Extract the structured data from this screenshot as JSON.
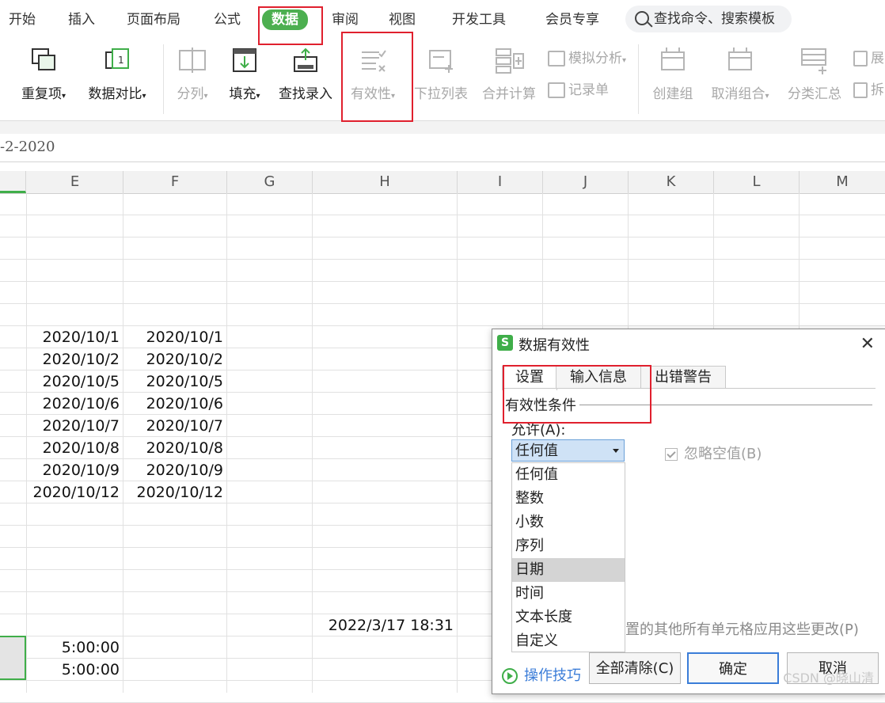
{
  "menubar": {
    "items": [
      "开始",
      "插入",
      "页面布局",
      "公式",
      "数据",
      "审阅",
      "视图",
      "开发工具",
      "会员专享"
    ],
    "active": "数据",
    "search_text": "查找命令、搜索模板"
  },
  "ribbon": {
    "buttons": [
      {
        "label": "重复项",
        "dropdown": true,
        "enabled": true,
        "icon": "duplicate-icon"
      },
      {
        "label": "数据对比",
        "dropdown": true,
        "enabled": true,
        "icon": "compare-icon"
      },
      {
        "label": "分列",
        "dropdown": true,
        "enabled": false,
        "icon": "split-column-icon"
      },
      {
        "label": "填充",
        "dropdown": true,
        "enabled": true,
        "icon": "fill-down-icon"
      },
      {
        "label": "查找录入",
        "dropdown": false,
        "enabled": true,
        "icon": "find-entry-icon"
      },
      {
        "label": "有效性",
        "dropdown": true,
        "enabled": false,
        "icon": "validation-icon"
      },
      {
        "label": "下拉列表",
        "dropdown": false,
        "enabled": false,
        "icon": "dropdown-list-icon"
      },
      {
        "label": "合并计算",
        "dropdown": false,
        "enabled": false,
        "icon": "consolidate-icon"
      },
      {
        "label": "创建组",
        "dropdown": false,
        "enabled": false,
        "icon": "group-icon"
      },
      {
        "label": "取消组合",
        "dropdown": true,
        "enabled": false,
        "icon": "ungroup-icon"
      },
      {
        "label": "分类汇总",
        "dropdown": false,
        "enabled": false,
        "icon": "subtotal-icon"
      }
    ],
    "small_buttons": [
      {
        "label": "模拟分析",
        "dropdown": true
      },
      {
        "label": "记录单",
        "dropdown": false
      }
    ],
    "partial": [
      "展",
      "拆"
    ]
  },
  "formula_bar": {
    "value": "-2-2020"
  },
  "grid": {
    "columns": [
      "E",
      "F",
      "G",
      "H",
      "I",
      "J",
      "K",
      "L",
      "M"
    ],
    "cells": [
      {
        "col": "E",
        "row": 7,
        "value": "2020/10/1"
      },
      {
        "col": "F",
        "row": 7,
        "value": "2020/10/1"
      },
      {
        "col": "E",
        "row": 8,
        "value": "2020/10/2"
      },
      {
        "col": "F",
        "row": 8,
        "value": "2020/10/2"
      },
      {
        "col": "E",
        "row": 9,
        "value": "2020/10/5"
      },
      {
        "col": "F",
        "row": 9,
        "value": "2020/10/5"
      },
      {
        "col": "E",
        "row": 10,
        "value": "2020/10/6"
      },
      {
        "col": "F",
        "row": 10,
        "value": "2020/10/6"
      },
      {
        "col": "E",
        "row": 11,
        "value": "2020/10/7"
      },
      {
        "col": "F",
        "row": 11,
        "value": "2020/10/7"
      },
      {
        "col": "E",
        "row": 12,
        "value": "2020/10/8"
      },
      {
        "col": "F",
        "row": 12,
        "value": "2020/10/8"
      },
      {
        "col": "E",
        "row": 13,
        "value": "2020/10/9"
      },
      {
        "col": "F",
        "row": 13,
        "value": "2020/10/9"
      },
      {
        "col": "E",
        "row": 14,
        "value": "2020/10/12"
      },
      {
        "col": "F",
        "row": 14,
        "value": "2020/10/12"
      },
      {
        "col": "H",
        "row": 20,
        "value": "2022/3/17 18:31"
      },
      {
        "col": "E",
        "row": 21,
        "value": "5:00:00"
      },
      {
        "col": "E",
        "row": 22,
        "value": "5:00:00"
      }
    ]
  },
  "dialog": {
    "title": "数据有效性",
    "tabs": [
      "设置",
      "输入信息",
      "出错警告"
    ],
    "active_tab": "设置",
    "section_label": "有效性条件",
    "allow_label": "允许(A):",
    "allow_value": "任何值",
    "options": [
      "任何值",
      "整数",
      "小数",
      "序列",
      "日期",
      "时间",
      "文本长度",
      "自定义"
    ],
    "hover_option": "日期",
    "ignore_blank_label": "忽略空值(B)",
    "ignore_blank_checked": true,
    "apply_all_label": "置的其他所有单元格应用这些更改(P)",
    "tips_label": "操作技巧",
    "clear_all_label": "全部清除(C)",
    "ok_label": "确定",
    "cancel_label": "取消",
    "logo_letter": "S"
  },
  "watermark": "CSDN @晓山清",
  "colors": {
    "accent": "#4caf50",
    "highlight": "#e0202e",
    "link": "#3b7dd8"
  }
}
